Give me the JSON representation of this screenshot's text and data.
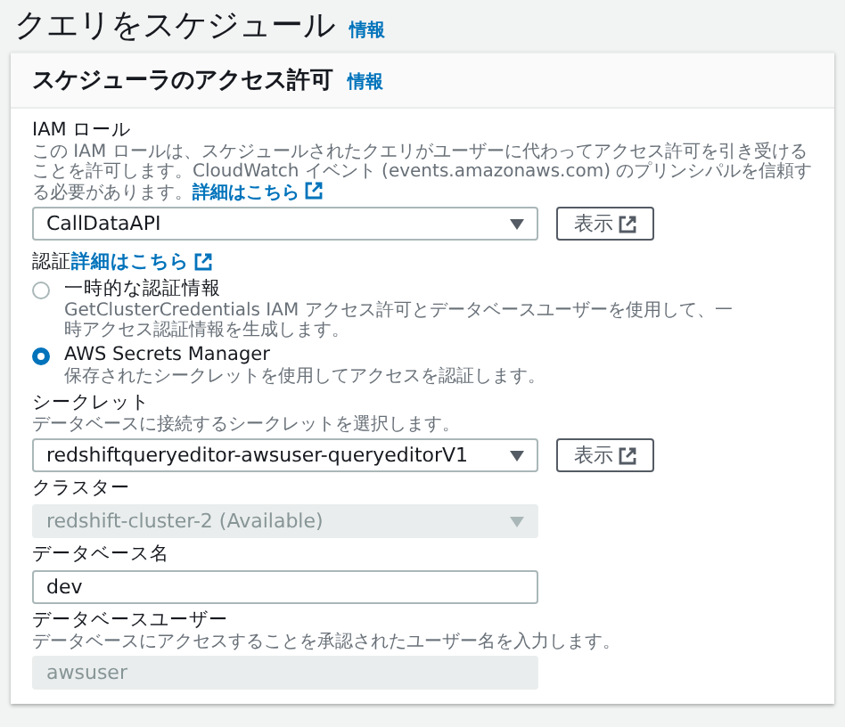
{
  "page": {
    "title": "クエリをスケジュール",
    "info_link": "情報"
  },
  "section": {
    "title": "スケジューラのアクセス許可",
    "info_link": "情報"
  },
  "iam_role": {
    "label": "IAM ロール",
    "description": "この IAM ロールは、スケジュールされたクエリがユーザーに代わってアクセス許可を引き受けることを許可します。CloudWatch イベント (events.amazonaws.com) のプリンシパルを信頼する必要があります。",
    "link": "詳細はこちら",
    "value": "CallDataAPI",
    "button": "表示"
  },
  "authentication": {
    "label": "認証",
    "link": "詳細はこちら",
    "options": [
      {
        "label": "一時的な認証情報",
        "description": "GetClusterCredentials IAM アクセス許可とデータベースユーザーを使用して、一時アクセス認証情報を生成します。",
        "selected": false
      },
      {
        "label": "AWS Secrets Manager",
        "description": "保存されたシークレットを使用してアクセスを認証します。",
        "selected": true
      }
    ]
  },
  "fields": [
    {
      "kind": "select",
      "label": "シークレット",
      "description": "データベースに接続するシークレットを選択します。",
      "value": "redshiftqueryeditor-awsuser-queryeditorV1",
      "button": "表示",
      "disabled": false
    },
    {
      "kind": "select",
      "label": "クラスター",
      "value": "redshift-cluster-2 (Available)",
      "disabled": true
    },
    {
      "kind": "input",
      "label": "データベース名",
      "value": "dev",
      "disabled": false
    },
    {
      "kind": "input",
      "label": "データベースユーザー",
      "description": "データベースにアクセスすることを承認されたユーザー名を入力します。",
      "value": "awsuser",
      "disabled": true
    }
  ]
}
